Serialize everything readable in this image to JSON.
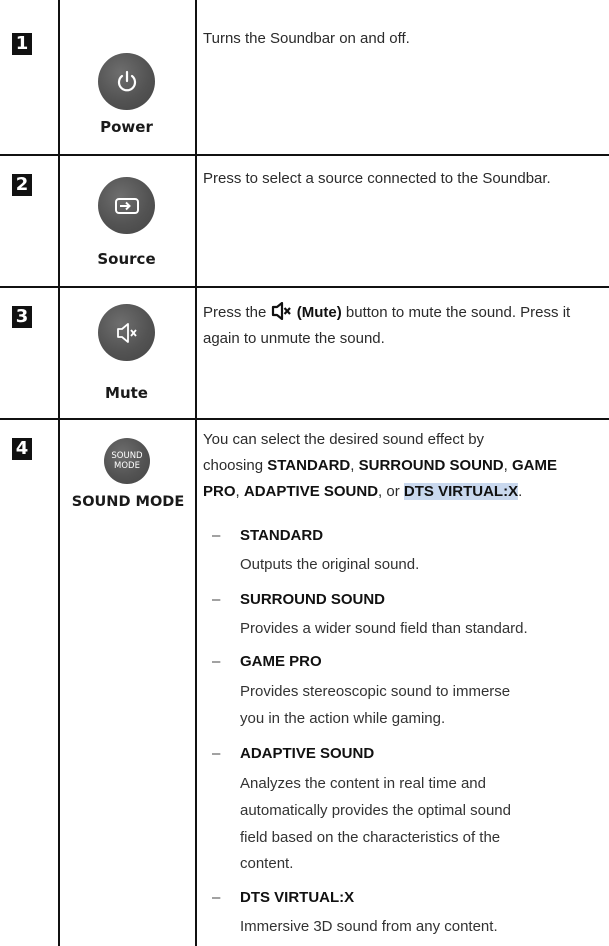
{
  "rows": [
    {
      "number": "1",
      "button_label": "Power",
      "icon": "power-icon",
      "description": "Turns the Soundbar on and off."
    },
    {
      "number": "2",
      "button_label": "Source",
      "icon": "source-icon",
      "description": "Press to select a source connected to the Soundbar."
    },
    {
      "number": "3",
      "button_label": "Mute",
      "icon": "mute-icon",
      "description_pre": "Press the",
      "description_bold": "(Mute)",
      "description_post": "button to mute the sound. Press it again to unmute the sound."
    },
    {
      "number": "4",
      "button_label": "SOUND MODE",
      "icon_text": [
        "SOUND",
        "MODE"
      ],
      "intro_1": "You can select the desired sound effect by",
      "intro_2_pre": "choosing",
      "intro_2_b1": "STANDARD",
      "intro_2_b2": "SURROUND SOUND",
      "intro_2_b3": "GAME",
      "intro_3_b1": "PRO",
      "intro_3_b2": "ADAPTIVE SOUND",
      "intro_3_or": "or",
      "intro_3_b3": "DTS VIRTUAL:X",
      "options": [
        {
          "title": "STANDARD",
          "lines": [
            "Outputs the original sound."
          ]
        },
        {
          "title": "SURROUND SOUND",
          "lines": [
            "Provides a wider sound field than standard."
          ]
        },
        {
          "title": "GAME PRO",
          "lines": [
            "Provides stereoscopic sound to immerse",
            "you in the action while gaming."
          ]
        },
        {
          "title": "ADAPTIVE SOUND",
          "lines": [
            "Analyzes the content in real time and",
            "automatically provides the optimal sound",
            "field based on the characteristics of the",
            "content."
          ]
        },
        {
          "title": "DTS VIRTUAL:X",
          "lines": [
            "Immersive 3D sound from any content."
          ]
        }
      ],
      "dash": "–"
    }
  ]
}
